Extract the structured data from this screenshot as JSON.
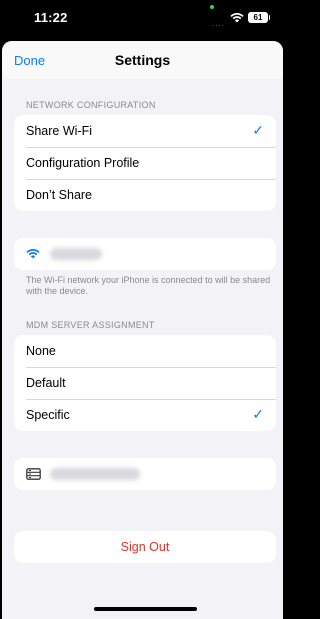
{
  "status_bar": {
    "time": "11:22",
    "battery_level": "61",
    "icons": [
      "wifi-icon",
      "battery-icon"
    ]
  },
  "nav": {
    "done_label": "Done",
    "title": "Settings"
  },
  "network_configuration": {
    "header": "NETWORK CONFIGURATION",
    "options": [
      {
        "label": "Share Wi-Fi",
        "selected": true
      },
      {
        "label": "Configuration Profile",
        "selected": false
      },
      {
        "label": "Don’t Share",
        "selected": false
      }
    ],
    "wifi_footer": "The Wi-Fi network your iPhone is connected to will be shared with the device."
  },
  "mdm_server_assignment": {
    "header": "MDM SERVER ASSIGNMENT",
    "options": [
      {
        "label": "None",
        "selected": false
      },
      {
        "label": "Default",
        "selected": false
      },
      {
        "label": "Specific",
        "selected": true
      }
    ]
  },
  "sign_out_label": "Sign Out",
  "check_glyph": "✓",
  "colors": {
    "accent": "#0a7cff",
    "destructive": "#e0302a",
    "background": "#f2f2f7"
  }
}
